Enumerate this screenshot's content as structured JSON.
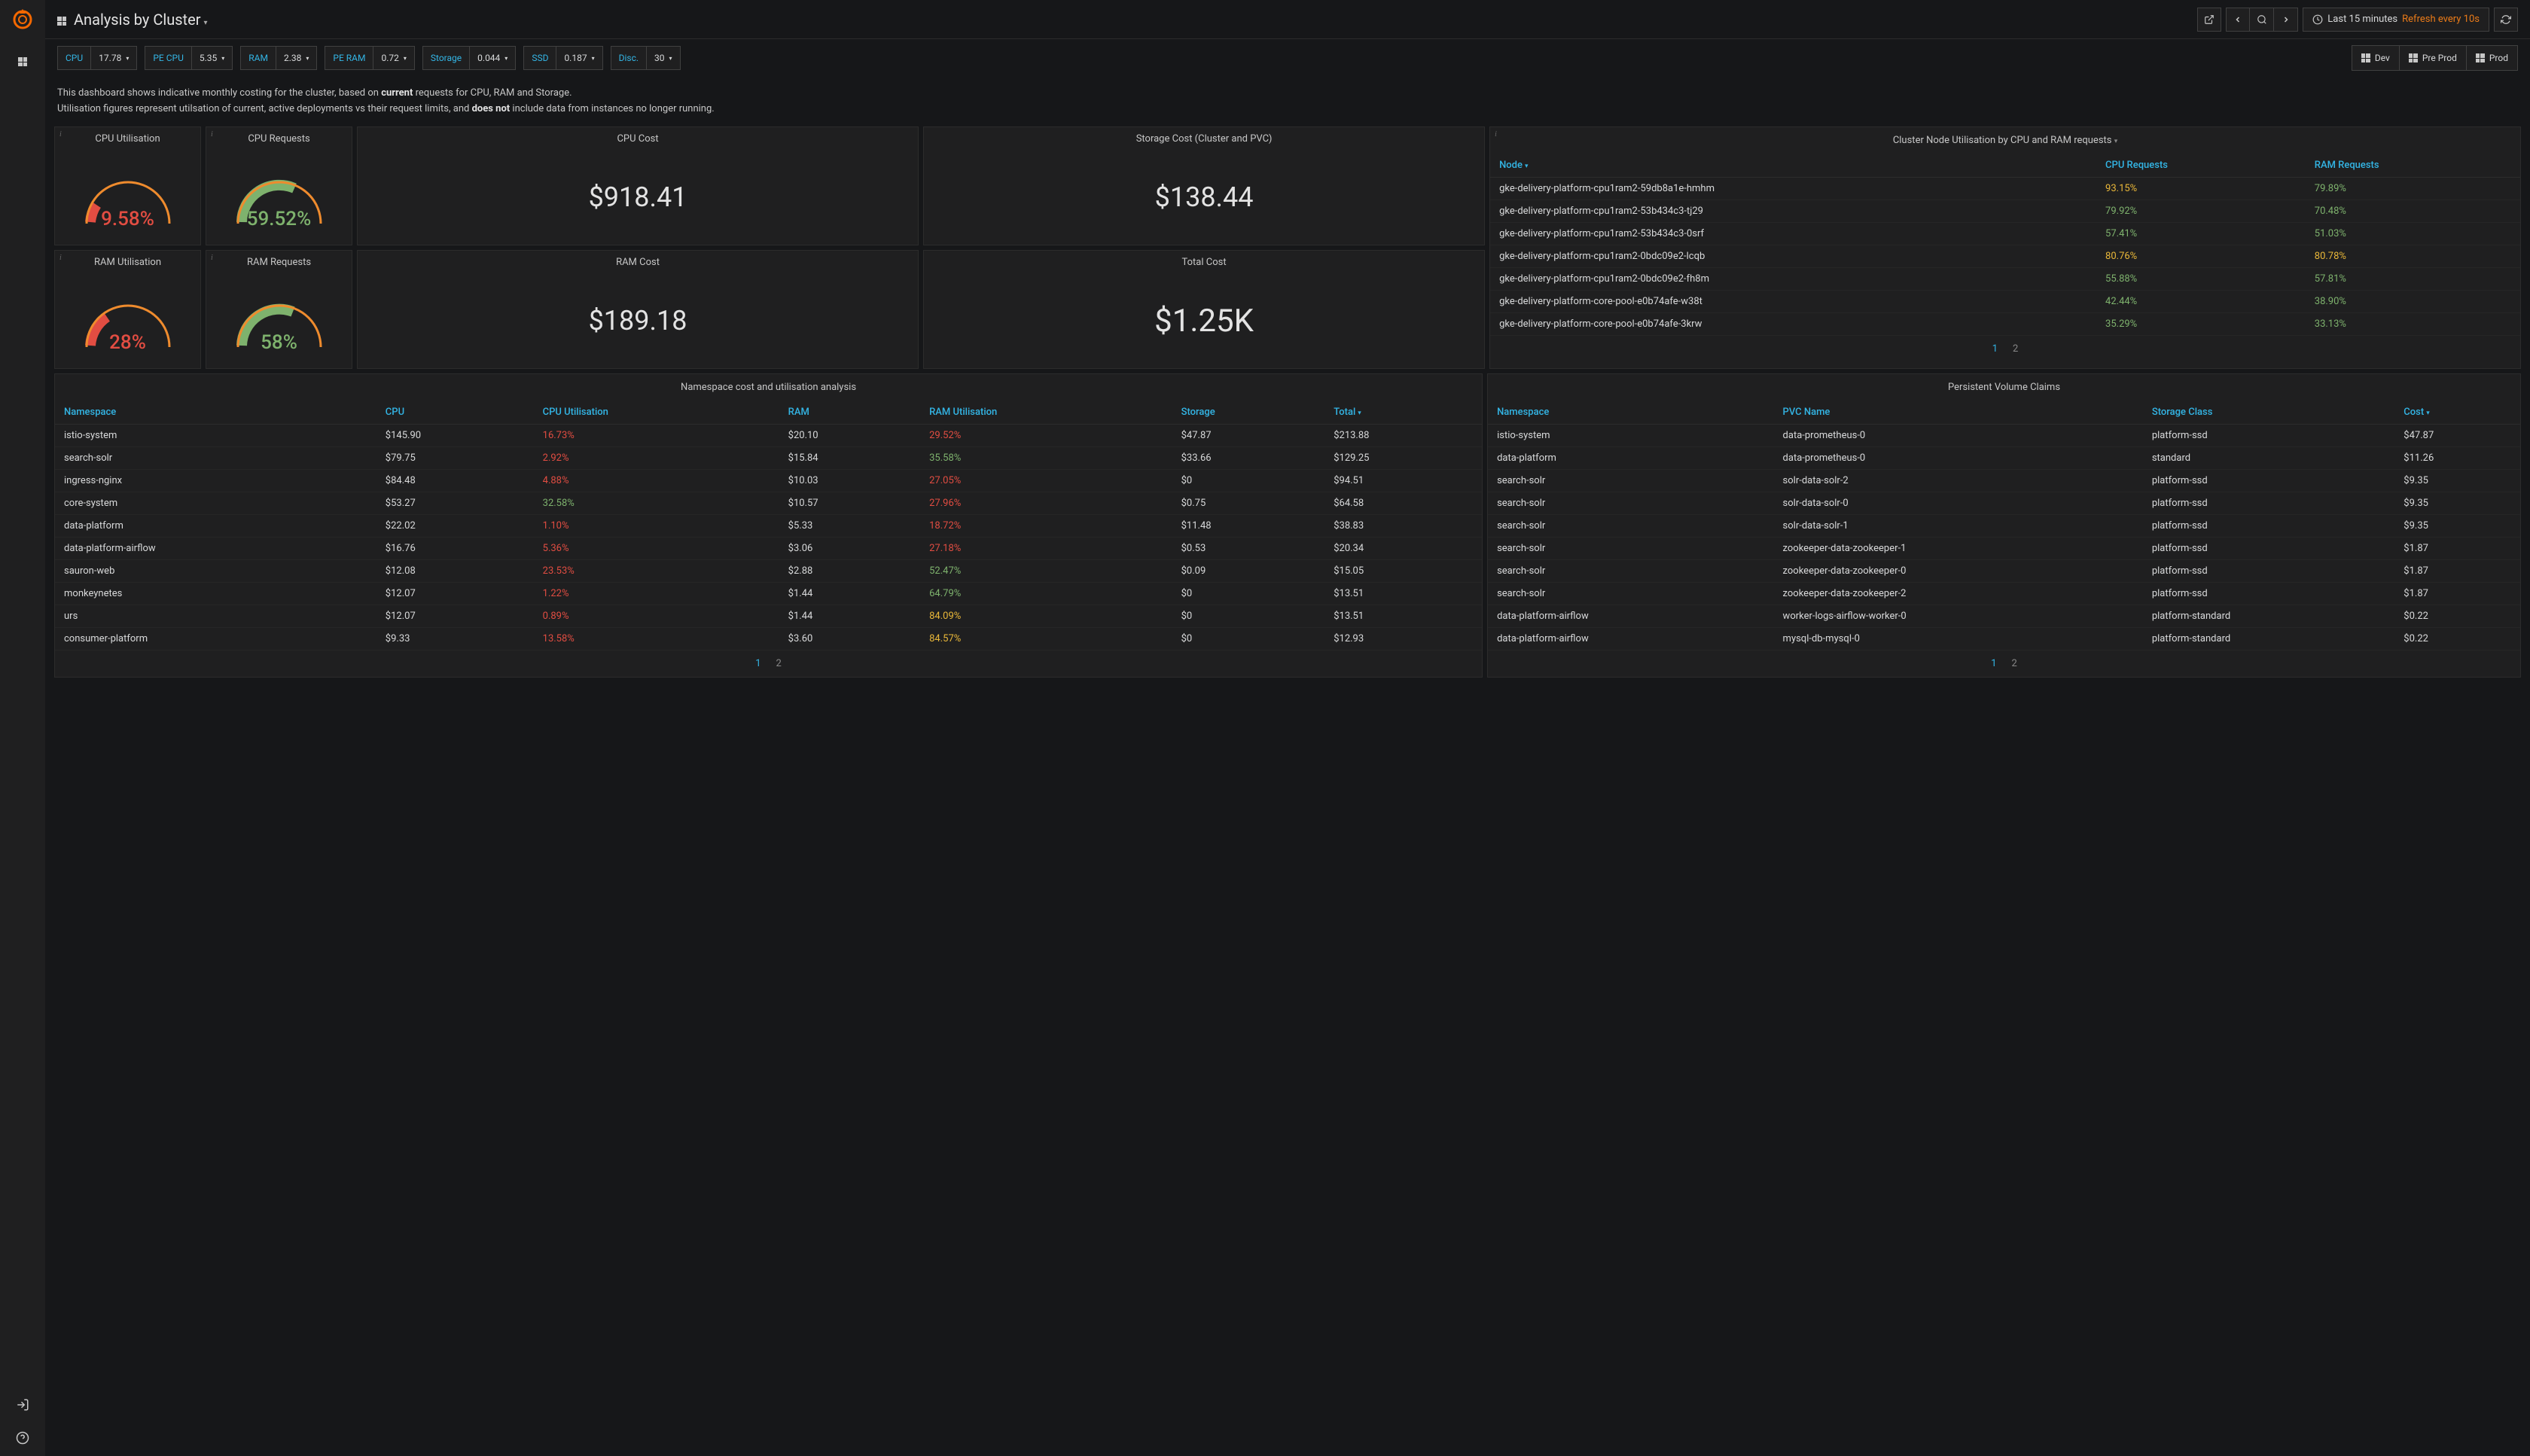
{
  "header": {
    "title": "Analysis by Cluster",
    "time_range": "Last 15 minutes",
    "refresh_label": "Refresh every 10s"
  },
  "vars": {
    "cpu_label": "CPU",
    "cpu_value": "17.78",
    "pecpu_label": "PE CPU",
    "pecpu_value": "5.35",
    "ram_label": "RAM",
    "ram_value": "2.38",
    "peram_label": "PE RAM",
    "peram_value": "0.72",
    "storage_label": "Storage",
    "storage_value": "0.044",
    "ssd_label": "SSD",
    "ssd_value": "0.187",
    "disc_label": "Disc.",
    "disc_value": "30"
  },
  "env_buttons": {
    "dev": "Dev",
    "preprod": "Pre Prod",
    "prod": "Prod"
  },
  "description": {
    "line1a": "This dashboard shows indicative monthly costing for the cluster, based on ",
    "line1b": "current",
    "line1c": " requests for CPU, RAM and Storage.",
    "line2a": "Utilisation figures represent utilsation of current, active deployments vs their request limits, and ",
    "line2b": "does not",
    "line2c": " include data from instances no longer running."
  },
  "gauges": {
    "cpu_util_title": "CPU Utilisation",
    "cpu_util_value": "9.58%",
    "cpu_req_title": "CPU Requests",
    "cpu_req_value": "59.52%",
    "ram_util_title": "RAM Utilisation",
    "ram_util_value": "28%",
    "ram_req_title": "RAM Requests",
    "ram_req_value": "58%"
  },
  "stats": {
    "cpu_cost_title": "CPU Cost",
    "cpu_cost_value": "$918.41",
    "storage_cost_title": "Storage Cost (Cluster and PVC)",
    "storage_cost_value": "$138.44",
    "ram_cost_title": "RAM Cost",
    "ram_cost_value": "$189.18",
    "total_cost_title": "Total Cost",
    "total_cost_value": "$1.25K"
  },
  "node_table": {
    "title": "Cluster Node Utilisation by CPU and RAM requests",
    "columns": {
      "node": "Node",
      "cpu": "CPU Requests",
      "ram": "RAM Requests"
    },
    "rows": [
      {
        "node": "gke-delivery-platform-cpu1ram2-59db8a1e-hmhm",
        "cpu": "93.15%",
        "cpu_cls": "val-orange",
        "ram": "79.89%",
        "ram_cls": "val-green"
      },
      {
        "node": "gke-delivery-platform-cpu1ram2-53b434c3-tj29",
        "cpu": "79.92%",
        "cpu_cls": "val-green",
        "ram": "70.48%",
        "ram_cls": "val-green"
      },
      {
        "node": "gke-delivery-platform-cpu1ram2-53b434c3-0srf",
        "cpu": "57.41%",
        "cpu_cls": "val-green",
        "ram": "51.03%",
        "ram_cls": "val-green"
      },
      {
        "node": "gke-delivery-platform-cpu1ram2-0bdc09e2-lcqb",
        "cpu": "80.76%",
        "cpu_cls": "val-orange",
        "ram": "80.78%",
        "ram_cls": "val-orange"
      },
      {
        "node": "gke-delivery-platform-cpu1ram2-0bdc09e2-fh8m",
        "cpu": "55.88%",
        "cpu_cls": "val-green",
        "ram": "57.81%",
        "ram_cls": "val-green"
      },
      {
        "node": "gke-delivery-platform-core-pool-e0b74afe-w38t",
        "cpu": "42.44%",
        "cpu_cls": "val-green",
        "ram": "38.90%",
        "ram_cls": "val-green"
      },
      {
        "node": "gke-delivery-platform-core-pool-e0b74afe-3krw",
        "cpu": "35.29%",
        "cpu_cls": "val-green",
        "ram": "33.13%",
        "ram_cls": "val-green"
      }
    ],
    "pages": {
      "p1": "1",
      "p2": "2"
    }
  },
  "ns_table": {
    "title": "Namespace cost and utilisation analysis",
    "columns": {
      "ns": "Namespace",
      "cpu": "CPU",
      "cpu_util": "CPU Utilisation",
      "ram": "RAM",
      "ram_util": "RAM Utilisation",
      "storage": "Storage",
      "total": "Total"
    },
    "rows": [
      {
        "ns": "istio-system",
        "cpu": "$145.90",
        "cpuu": "16.73%",
        "cpuu_cls": "val-red",
        "ram": "$20.10",
        "ramu": "29.52%",
        "ramu_cls": "val-red",
        "storage": "$47.87",
        "total": "$213.88"
      },
      {
        "ns": "search-solr",
        "cpu": "$79.75",
        "cpuu": "2.92%",
        "cpuu_cls": "val-red",
        "ram": "$15.84",
        "ramu": "35.58%",
        "ramu_cls": "val-green",
        "storage": "$33.66",
        "total": "$129.25"
      },
      {
        "ns": "ingress-nginx",
        "cpu": "$84.48",
        "cpuu": "4.88%",
        "cpuu_cls": "val-red",
        "ram": "$10.03",
        "ramu": "27.05%",
        "ramu_cls": "val-red",
        "storage": "$0",
        "total": "$94.51"
      },
      {
        "ns": "core-system",
        "cpu": "$53.27",
        "cpuu": "32.58%",
        "cpuu_cls": "val-green",
        "ram": "$10.57",
        "ramu": "27.96%",
        "ramu_cls": "val-red",
        "storage": "$0.75",
        "total": "$64.58"
      },
      {
        "ns": "data-platform",
        "cpu": "$22.02",
        "cpuu": "1.10%",
        "cpuu_cls": "val-red",
        "ram": "$5.33",
        "ramu": "18.72%",
        "ramu_cls": "val-red",
        "storage": "$11.48",
        "total": "$38.83"
      },
      {
        "ns": "data-platform-airflow",
        "cpu": "$16.76",
        "cpuu": "5.36%",
        "cpuu_cls": "val-red",
        "ram": "$3.06",
        "ramu": "27.18%",
        "ramu_cls": "val-red",
        "storage": "$0.53",
        "total": "$20.34"
      },
      {
        "ns": "sauron-web",
        "cpu": "$12.08",
        "cpuu": "23.53%",
        "cpuu_cls": "val-red",
        "ram": "$2.88",
        "ramu": "52.47%",
        "ramu_cls": "val-green",
        "storage": "$0.09",
        "total": "$15.05"
      },
      {
        "ns": "monkeynetes",
        "cpu": "$12.07",
        "cpuu": "1.22%",
        "cpuu_cls": "val-red",
        "ram": "$1.44",
        "ramu": "64.79%",
        "ramu_cls": "val-green",
        "storage": "$0",
        "total": "$13.51"
      },
      {
        "ns": "urs",
        "cpu": "$12.07",
        "cpuu": "0.89%",
        "cpuu_cls": "val-red",
        "ram": "$1.44",
        "ramu": "84.09%",
        "ramu_cls": "val-orange",
        "storage": "$0",
        "total": "$13.51"
      },
      {
        "ns": "consumer-platform",
        "cpu": "$9.33",
        "cpuu": "13.58%",
        "cpuu_cls": "val-red",
        "ram": "$3.60",
        "ramu": "84.57%",
        "ramu_cls": "val-orange",
        "storage": "$0",
        "total": "$12.93"
      }
    ],
    "pages": {
      "p1": "1",
      "p2": "2"
    }
  },
  "pvc_table": {
    "title": "Persistent Volume Claims",
    "columns": {
      "ns": "Namespace",
      "pvc": "PVC Name",
      "sc": "Storage Class",
      "cost": "Cost"
    },
    "rows": [
      {
        "ns": "istio-system",
        "pvc": "data-prometheus-0",
        "sc": "platform-ssd",
        "cost": "$47.87"
      },
      {
        "ns": "data-platform",
        "pvc": "data-prometheus-0",
        "sc": "standard",
        "cost": "$11.26"
      },
      {
        "ns": "search-solr",
        "pvc": "solr-data-solr-2",
        "sc": "platform-ssd",
        "cost": "$9.35"
      },
      {
        "ns": "search-solr",
        "pvc": "solr-data-solr-0",
        "sc": "platform-ssd",
        "cost": "$9.35"
      },
      {
        "ns": "search-solr",
        "pvc": "solr-data-solr-1",
        "sc": "platform-ssd",
        "cost": "$9.35"
      },
      {
        "ns": "search-solr",
        "pvc": "zookeeper-data-zookeeper-1",
        "sc": "platform-ssd",
        "cost": "$1.87"
      },
      {
        "ns": "search-solr",
        "pvc": "zookeeper-data-zookeeper-0",
        "sc": "platform-ssd",
        "cost": "$1.87"
      },
      {
        "ns": "search-solr",
        "pvc": "zookeeper-data-zookeeper-2",
        "sc": "platform-ssd",
        "cost": "$1.87"
      },
      {
        "ns": "data-platform-airflow",
        "pvc": "worker-logs-airflow-worker-0",
        "sc": "platform-standard",
        "cost": "$0.22"
      },
      {
        "ns": "data-platform-airflow",
        "pvc": "mysql-db-mysql-0",
        "sc": "platform-standard",
        "cost": "$0.22"
      }
    ],
    "pages": {
      "p1": "1",
      "p2": "2"
    }
  },
  "chart_data": [
    {
      "type": "gauge",
      "title": "CPU Utilisation",
      "value": 9.58,
      "unit": "%",
      "min": 0,
      "max": 100,
      "color": "red"
    },
    {
      "type": "gauge",
      "title": "CPU Requests",
      "value": 59.52,
      "unit": "%",
      "min": 0,
      "max": 100,
      "color": "green"
    },
    {
      "type": "gauge",
      "title": "RAM Utilisation",
      "value": 28,
      "unit": "%",
      "min": 0,
      "max": 100,
      "color": "red"
    },
    {
      "type": "gauge",
      "title": "RAM Requests",
      "value": 58,
      "unit": "%",
      "min": 0,
      "max": 100,
      "color": "green"
    }
  ]
}
